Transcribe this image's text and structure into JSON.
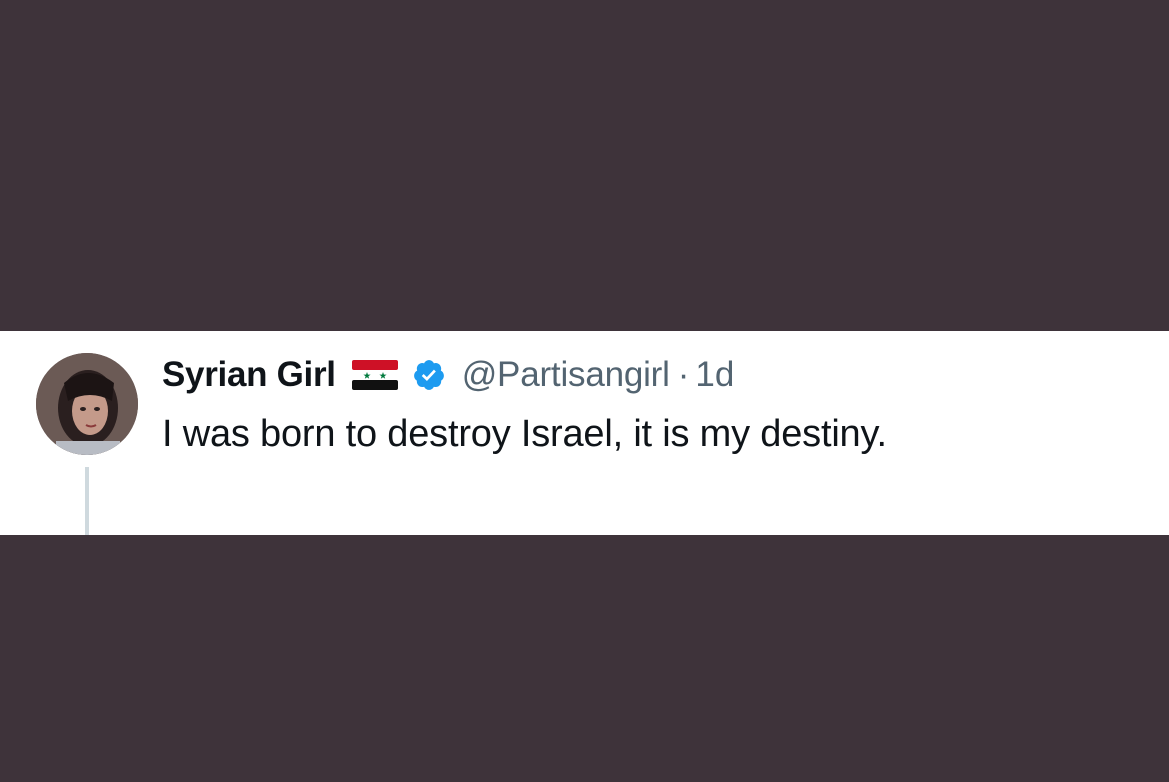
{
  "tweet": {
    "display_name": "Syrian Girl",
    "flag_icon": "syria-flag-icon",
    "verified_icon": "verified-badge-icon",
    "handle": "@Partisangirl",
    "separator": "·",
    "timestamp": "1d",
    "text": "I was born to destroy Israel, it is my destiny."
  },
  "colors": {
    "background": "#3e333a",
    "card": "#ffffff",
    "name": "#0f1419",
    "secondary": "#536471",
    "verified": "#1d9bf0",
    "thread_line": "#cfd9de"
  }
}
